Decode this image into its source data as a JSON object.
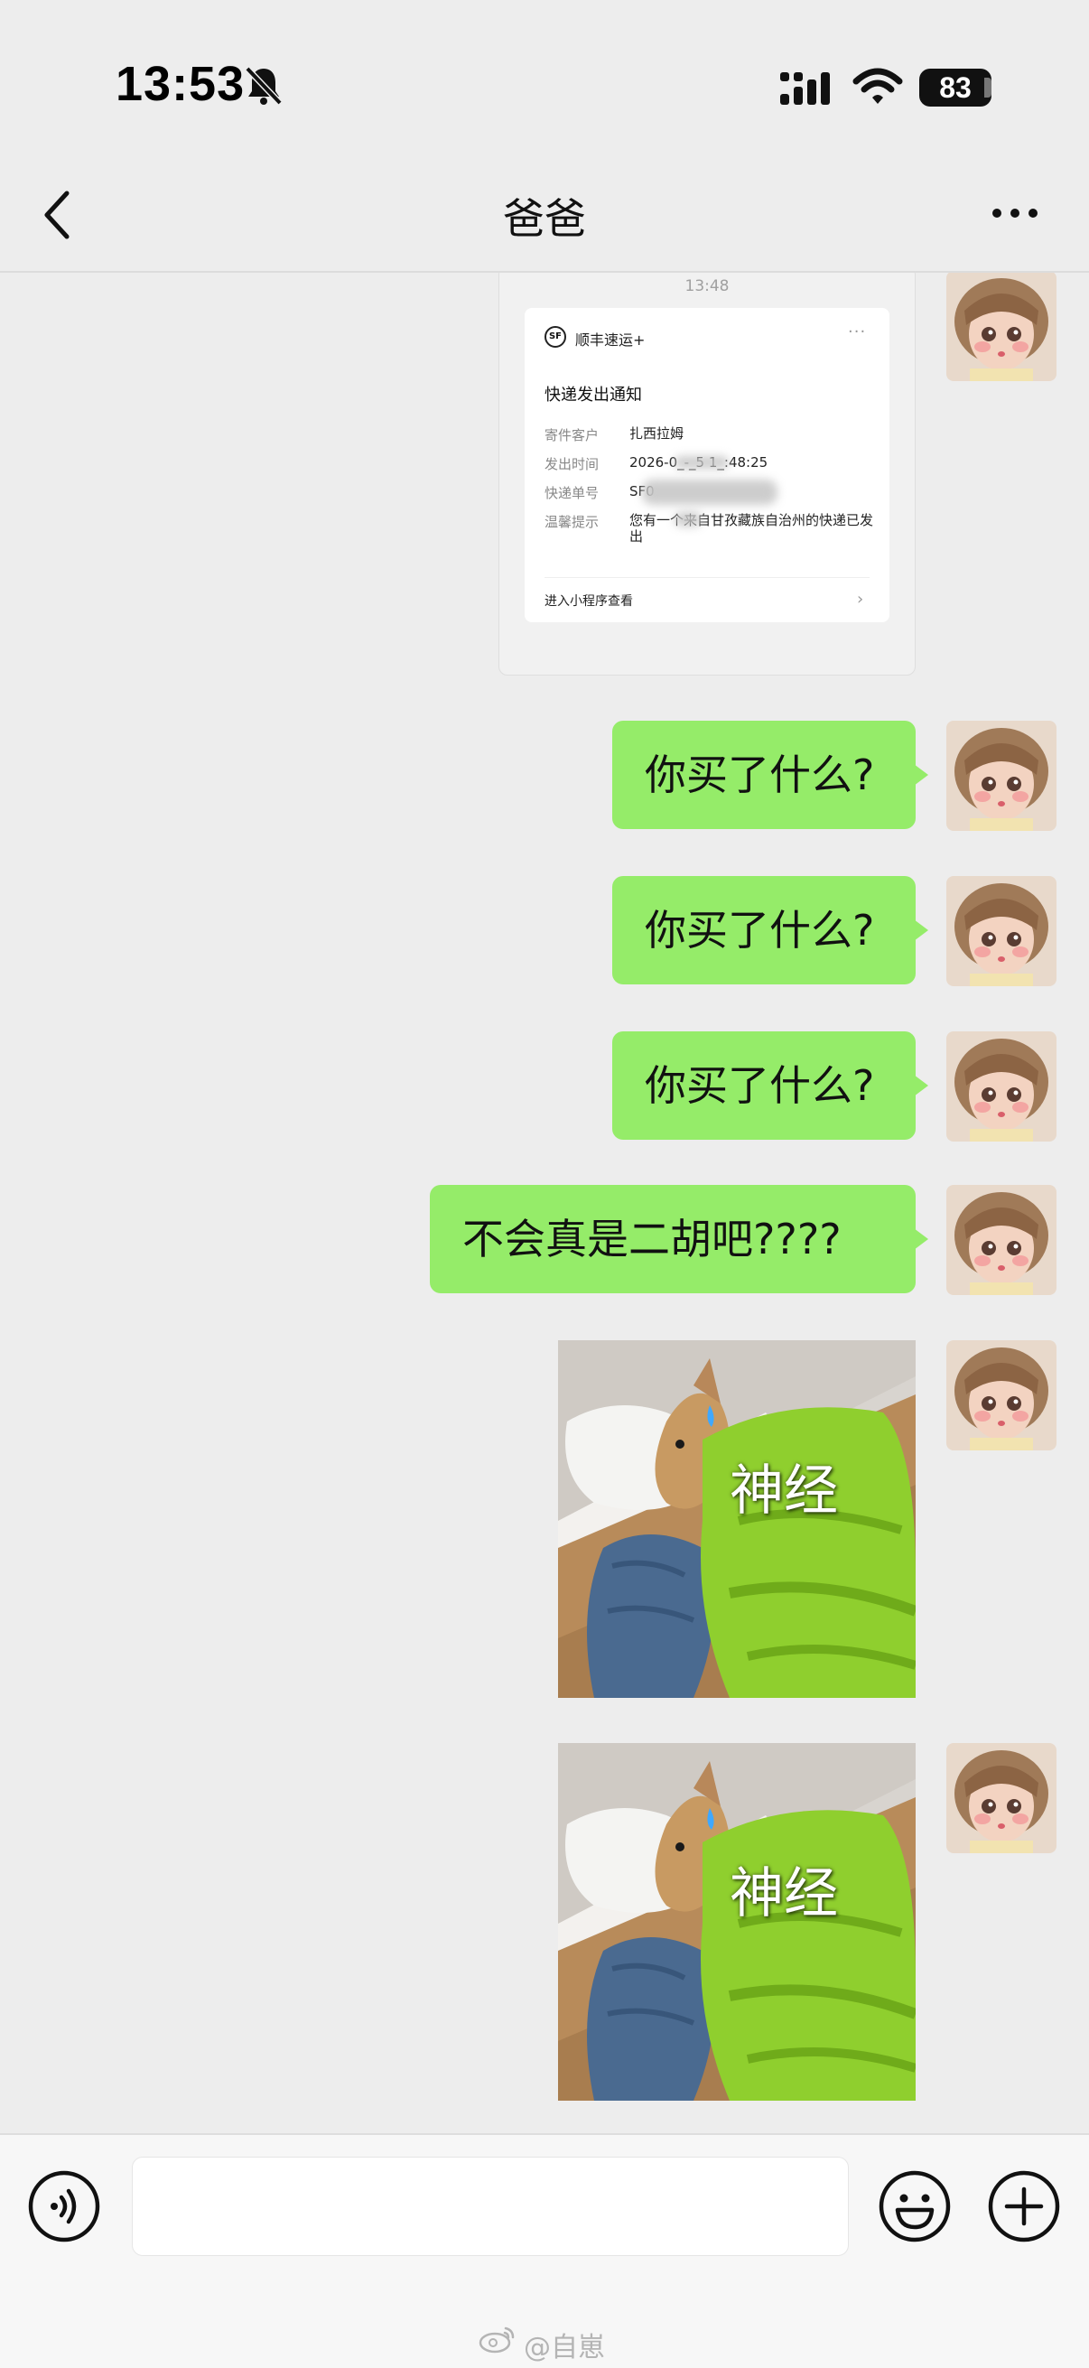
{
  "status_bar": {
    "time": "13:53",
    "battery": "83",
    "icons": [
      "bell-slash-icon",
      "cellular-signal-icon",
      "wifi-icon",
      "battery-icon"
    ]
  },
  "nav": {
    "title": "爸爸",
    "icons": [
      "back-chevron-icon",
      "more-dots-icon"
    ]
  },
  "messages": {
    "card": {
      "time": "13:48",
      "brand": "顺丰速运+",
      "logo": "SF",
      "more": "···",
      "title": "快递发出通知",
      "rows": [
        {
          "label": "寄件客户",
          "value": "扎西拉姆"
        },
        {
          "label": "发出时间",
          "value": "2026-0_-_5 1_:48:25"
        },
        {
          "label": "快递单号",
          "value": "SF0"
        },
        {
          "label": "温馨提示",
          "value": "您有一个来自甘孜藏族自治州的快递已发出"
        }
      ],
      "footer": "进入小程序查看",
      "chevron": "›"
    },
    "texts": [
      "你买了什么?",
      "你买了什么?",
      "你买了什么?",
      "不会真是二胡吧????"
    ],
    "stickers": [
      {
        "caption": "神经"
      },
      {
        "caption": "神经"
      }
    ]
  },
  "input_bar": {
    "input_value": "",
    "icons": [
      "voice-icon",
      "emoji-icon",
      "plus-icon"
    ]
  },
  "watermark": "@自崽",
  "colors": {
    "background": "#ededed",
    "bubble_green": "#95ec69",
    "input_bar": "#f7f7f7"
  }
}
